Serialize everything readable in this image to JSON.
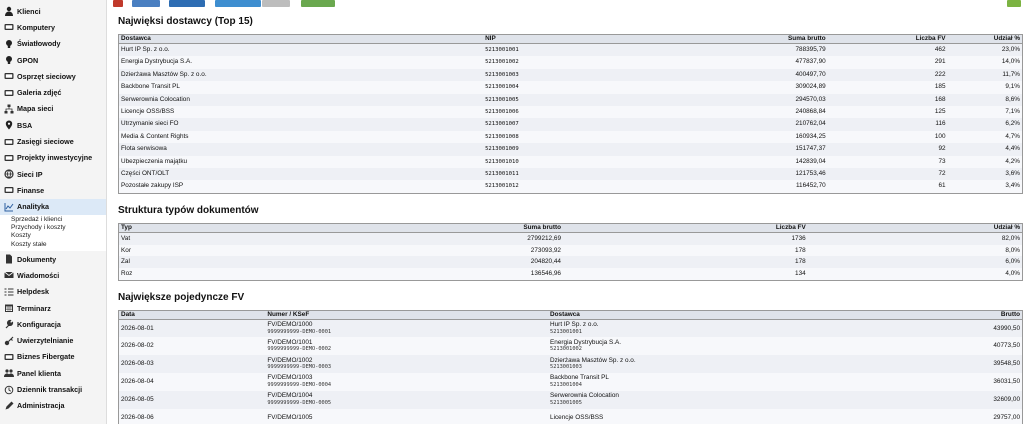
{
  "sidebar": {
    "items": [
      {
        "label": "Klienci",
        "icon": "user-icon"
      },
      {
        "label": "Komputery",
        "icon": "computer-icon"
      },
      {
        "label": "Światłowody",
        "icon": "bulb-icon"
      },
      {
        "label": "GPON",
        "icon": "bulb-icon"
      },
      {
        "label": "Osprzęt sieciowy",
        "icon": "device-icon"
      },
      {
        "label": "Galeria zdjęć",
        "icon": "image-icon"
      },
      {
        "label": "Mapa sieci",
        "icon": "network-icon"
      },
      {
        "label": "BSA",
        "icon": "pin-icon"
      },
      {
        "label": "Zasięgi sieciowe",
        "icon": "signal-icon"
      },
      {
        "label": "Projekty inwestycyjne",
        "icon": "project-icon"
      },
      {
        "label": "Sieci IP",
        "icon": "globe-icon"
      },
      {
        "label": "Finanse",
        "icon": "money-icon"
      },
      {
        "label": "Analityka",
        "icon": "chart-icon",
        "active": true
      },
      {
        "label": "Dokumenty",
        "icon": "document-icon"
      },
      {
        "label": "Wiadomości",
        "icon": "mail-icon"
      },
      {
        "label": "Helpdesk",
        "icon": "list-icon"
      },
      {
        "label": "Terminarz",
        "icon": "calendar-icon"
      },
      {
        "label": "Konfiguracja",
        "icon": "wrench-icon"
      },
      {
        "label": "Uwierzytelnianie",
        "icon": "key-icon"
      },
      {
        "label": "Biznes Fibergate",
        "icon": "building-icon"
      },
      {
        "label": "Panel klienta",
        "icon": "users-icon"
      },
      {
        "label": "Dziennik transakcji",
        "icon": "history-icon"
      },
      {
        "label": "Administracja",
        "icon": "pen-icon"
      }
    ],
    "analityka_sub": [
      "Sprzedaż i klienci",
      "Przychody i koszty",
      "Koszty",
      "Koszty stałe"
    ]
  },
  "suppliers": {
    "title": "Najwięksi dostawcy (Top 15)",
    "headers": [
      "Dostawca",
      "NIP",
      "Suma brutto",
      "Liczba FV",
      "Udział %"
    ],
    "rows": [
      [
        "Hurt IP Sp. z o.o.",
        "5213001001",
        "788395,79",
        "462",
        "23,0%"
      ],
      [
        "Energia Dystrybucja S.A.",
        "5213001002",
        "477837,90",
        "291",
        "14,0%"
      ],
      [
        "Dzierżawa Masztów Sp. z o.o.",
        "5213001003",
        "400497,70",
        "222",
        "11,7%"
      ],
      [
        "Backbone Transit PL",
        "5213001004",
        "309024,89",
        "185",
        "9,1%"
      ],
      [
        "Serwerownia Colocation",
        "5213001005",
        "294570,03",
        "168",
        "8,6%"
      ],
      [
        "Licencje OSS/BSS",
        "5213001006",
        "240868,84",
        "125",
        "7,1%"
      ],
      [
        "Utrzymanie sieci FO",
        "5213001007",
        "210762,04",
        "116",
        "6,2%"
      ],
      [
        "Media & Content Rights",
        "5213001008",
        "160934,25",
        "100",
        "4,7%"
      ],
      [
        "Flota serwisowa",
        "5213001009",
        "151747,37",
        "92",
        "4,4%"
      ],
      [
        "Ubezpieczenia majątku",
        "5213001010",
        "142839,04",
        "73",
        "4,2%"
      ],
      [
        "Części ONT/OLT",
        "5213001011",
        "121753,46",
        "72",
        "3,6%"
      ],
      [
        "Pozostałe zakupy ISP",
        "5213001012",
        "116452,70",
        "61",
        "3,4%"
      ]
    ]
  },
  "doc_types": {
    "title": "Struktura typów dokumentów",
    "headers": [
      "Typ",
      "Suma brutto",
      "Liczba FV",
      "Udział %"
    ],
    "rows": [
      [
        "Vat",
        "2799212,69",
        "1736",
        "82,0%"
      ],
      [
        "Kor",
        "273093,92",
        "178",
        "8,0%"
      ],
      [
        "Zal",
        "204820,44",
        "178",
        "6,0%"
      ],
      [
        "Roz",
        "136546,96",
        "134",
        "4,0%"
      ]
    ]
  },
  "largest_fv": {
    "title": "Największe pojedyncze FV",
    "headers": [
      "Data",
      "Numer / KSeF",
      "Dostawca",
      "Brutto"
    ],
    "rows": [
      {
        "date": "2026-08-01",
        "num": "FV/DEMO/1000",
        "ksef": "9999999999-DEMO-0001",
        "supplier": "Hurt IP Sp. z o.o.",
        "nip": "5213001001",
        "gross": "43990,50"
      },
      {
        "date": "2026-08-02",
        "num": "FV/DEMO/1001",
        "ksef": "9999999999-DEMO-0002",
        "supplier": "Energia Dystrybucja S.A.",
        "nip": "5213001002",
        "gross": "40773,50"
      },
      {
        "date": "2026-08-03",
        "num": "FV/DEMO/1002",
        "ksef": "9999999999-DEMO-0003",
        "supplier": "Dzierżawa Masztów Sp. z o.o.",
        "nip": "5213001003",
        "gross": "39548,50"
      },
      {
        "date": "2026-08-04",
        "num": "FV/DEMO/1003",
        "ksef": "9999999999-DEMO-0004",
        "supplier": "Backbone Transit PL",
        "nip": "5213001004",
        "gross": "36031,50"
      },
      {
        "date": "2026-08-05",
        "num": "FV/DEMO/1004",
        "ksef": "9999999999-DEMO-0005",
        "supplier": "Serwerownia Colocation",
        "nip": "5213001005",
        "gross": "32609,00"
      },
      {
        "date": "2026-08-06",
        "num": "FV/DEMO/1005",
        "ksef": "",
        "supplier": "Licencje OSS/BSS",
        "nip": "",
        "gross": "29757,00"
      }
    ]
  },
  "colors": {
    "accent": "#dce9f7",
    "header_bg": "#dfe3ea",
    "row_bg": "#eef0f5"
  }
}
